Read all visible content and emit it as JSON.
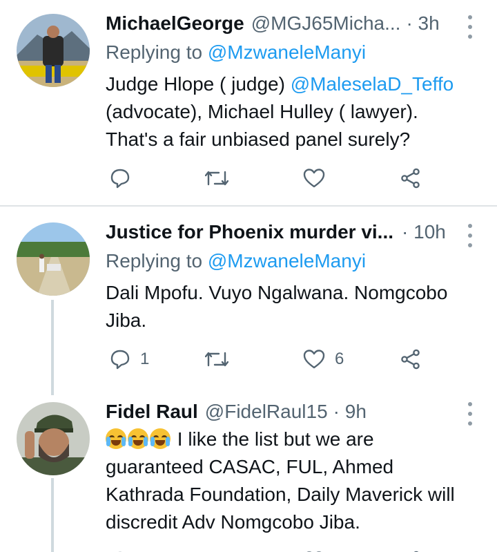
{
  "tweets": [
    {
      "name": "MichaelGeorge",
      "handle": "@MGJ65Micha...",
      "time": "· 3h",
      "replying_prefix": "Replying to ",
      "replying_to": "@MzwaneleManyi",
      "text_parts": [
        "Judge Hlope ( judge) ",
        "@MaleselaD_Teffo",
        "(advocate), Michael Hulley ( lawyer).",
        "That's a fair unbiased panel surely?"
      ],
      "reply_count": "",
      "like_count": ""
    },
    {
      "name": "Justice for Phoenix murder vi...",
      "handle": "",
      "time": "· 10h",
      "replying_prefix": "Replying to ",
      "replying_to": "@MzwaneleManyi",
      "text_lines": [
        "Dali Mpofu. Vuyo Ngalwana. Nomgcobo",
        "Jiba."
      ],
      "reply_count": "1",
      "like_count": "6"
    },
    {
      "name": "Fidel Raul",
      "handle": "@FidelRaul15",
      "time": "· 9h",
      "emoji": "😂😂😂",
      "text_lines": [
        "I like the list but we are",
        "guaranteed CASAC, FUL, Ahmed",
        "Kathrada Foundation, Daily Maverick will",
        "discredit Adv Nomgcobo Jiba."
      ]
    }
  ],
  "icons": [
    "reply-icon",
    "retweet-icon",
    "like-icon",
    "share-icon",
    "more-icon"
  ],
  "colors": {
    "text": "#0f1419",
    "secondary": "#536471",
    "link": "#1d9bf0",
    "divider": "#dfe3e6"
  }
}
